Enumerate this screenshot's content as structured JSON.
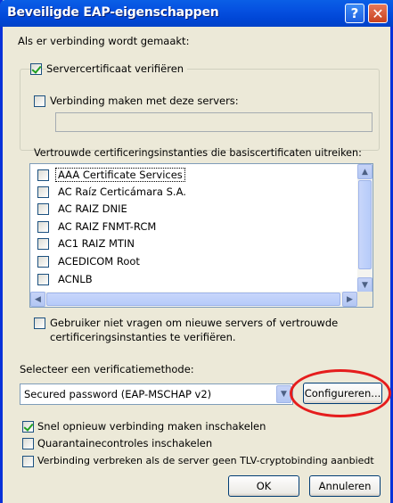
{
  "window": {
    "title": "Beveiligde EAP-eigenschappen",
    "help_glyph": "?",
    "close_glyph": "✕"
  },
  "connect_label": "Als er verbinding wordt gemaakt:",
  "verify_cert": {
    "label": "Servercertificaat verifiëren",
    "checked": true
  },
  "connect_servers": {
    "label": "Verbinding maken met deze servers:",
    "checked": false,
    "value": ""
  },
  "trusted_ca_label": "Vertrouwde certificeringsinstanties die basiscertificaten uitreiken:",
  "ca_list": [
    {
      "label": "AAA Certificate Services",
      "checked": false
    },
    {
      "label": "AC Raíz Certicámara S.A.",
      "checked": false
    },
    {
      "label": "AC RAIZ DNIE",
      "checked": false
    },
    {
      "label": "AC RAIZ FNMT-RCM",
      "checked": false
    },
    {
      "label": "AC1 RAIZ MTIN",
      "checked": false
    },
    {
      "label": "ACEDICOM Root",
      "checked": false
    },
    {
      "label": "ACNLB",
      "checked": false
    }
  ],
  "no_prompt": {
    "label_line1": "Gebruiker niet vragen om nieuwe servers of vertrouwde",
    "label_line2": "certificeringsinstanties te verifiëren.",
    "checked": false
  },
  "method_label": "Selecteer een verificatiemethode:",
  "method_select": {
    "value": "Secured password (EAP-MSCHAP v2)"
  },
  "configure_button": "Configureren...",
  "fast_reconnect": {
    "label": "Snel opnieuw verbinding maken inschakelen",
    "checked": true
  },
  "quarantine": {
    "label": "Quarantainecontroles inschakelen",
    "checked": false
  },
  "tlv_disconnect": {
    "label": "Verbinding verbreken als de server geen TLV-cryptobinding aanbiedt",
    "checked": false
  },
  "ok_button": "OK",
  "cancel_button": "Annuleren",
  "colors": {
    "titlebar": "#0054e3",
    "dialog_bg": "#ece9d8",
    "annotation": "#e51d1d"
  }
}
